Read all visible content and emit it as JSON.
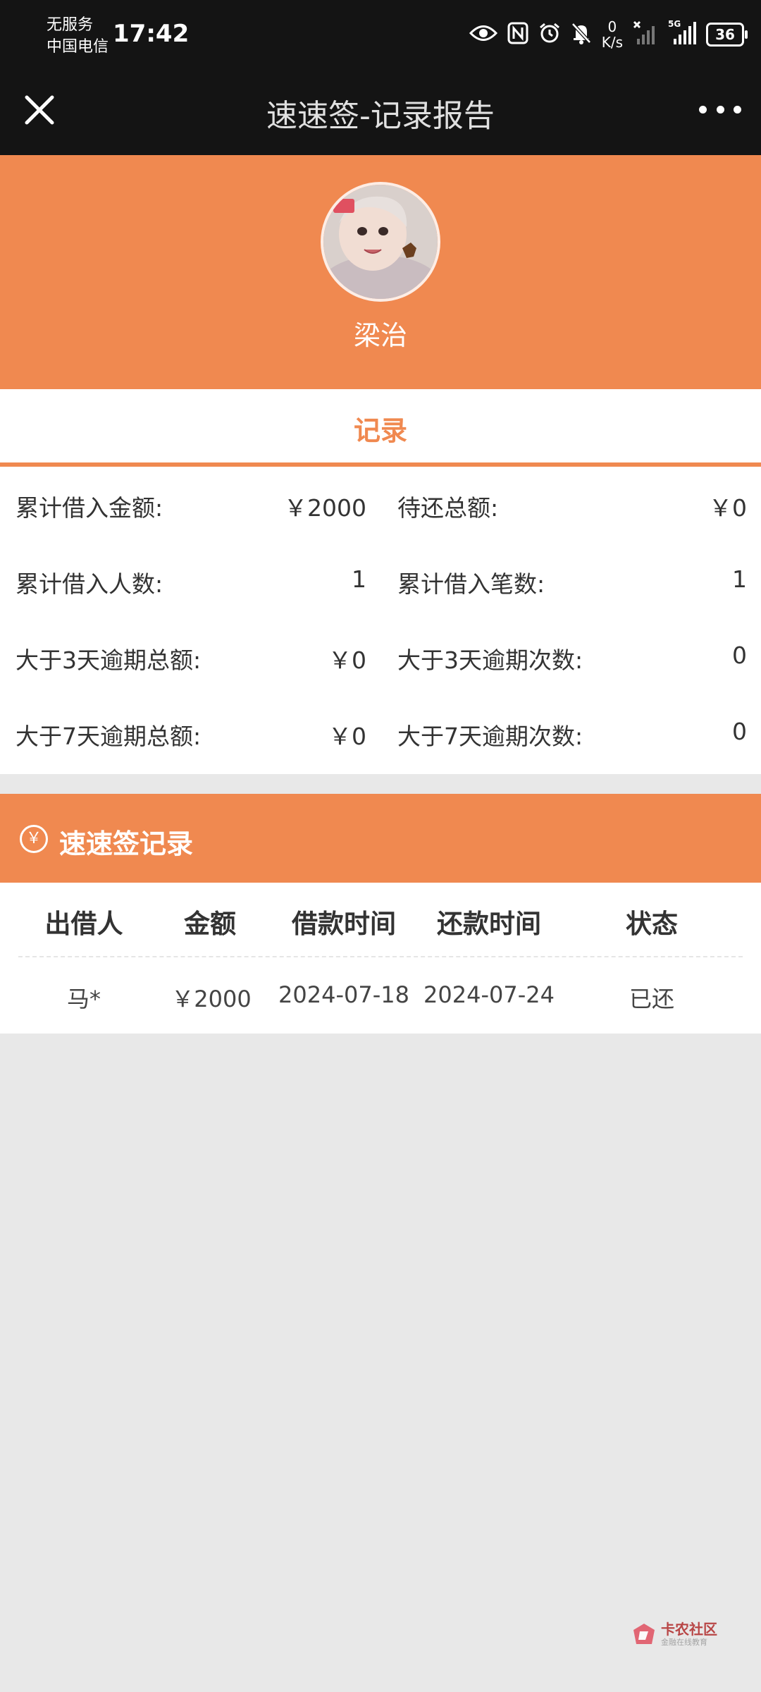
{
  "status_bar": {
    "carrier_line1": "无服务",
    "carrier_line2": "中国电信",
    "time": "17:42",
    "net_speed_value": "0",
    "net_speed_unit": "K/s",
    "signal_label": "5G",
    "battery_level": "36",
    "icons": [
      "eye-icon",
      "nfc-icon",
      "alarm-icon",
      "bell-off-icon",
      "signal-no-service-icon",
      "signal-5g-icon",
      "battery-icon"
    ]
  },
  "titlebar": {
    "title": "速速签-记录报告"
  },
  "profile": {
    "name": "梁治"
  },
  "tab": {
    "label": "记录"
  },
  "stats": [
    {
      "label": "累计借入金额:",
      "value": "￥2000"
    },
    {
      "label": "待还总额:",
      "value": "￥0"
    },
    {
      "label": "累计借入人数:",
      "value": "1"
    },
    {
      "label": "累计借入笔数:",
      "value": "1"
    },
    {
      "label": "大于3天逾期总额:",
      "value": "￥0"
    },
    {
      "label": "大于3天逾期次数:",
      "value": "0"
    },
    {
      "label": "大于7天逾期总额:",
      "value": "￥0"
    },
    {
      "label": "大于7天逾期次数:",
      "value": "0"
    }
  ],
  "records": {
    "icon_glyph": "￥",
    "title": "速速签记录",
    "columns": [
      "出借人",
      "金额",
      "借款时间",
      "还款时间",
      "状态"
    ],
    "rows": [
      [
        "马*",
        "￥2000",
        "2024-07-18",
        "2024-07-24",
        "已还"
      ]
    ]
  },
  "watermark": {
    "main": "卡农社区",
    "sub": "金融在线教育"
  },
  "colors": {
    "accent": "#f08950",
    "topbar": "#141414",
    "page_bg": "#e8e8e8"
  }
}
